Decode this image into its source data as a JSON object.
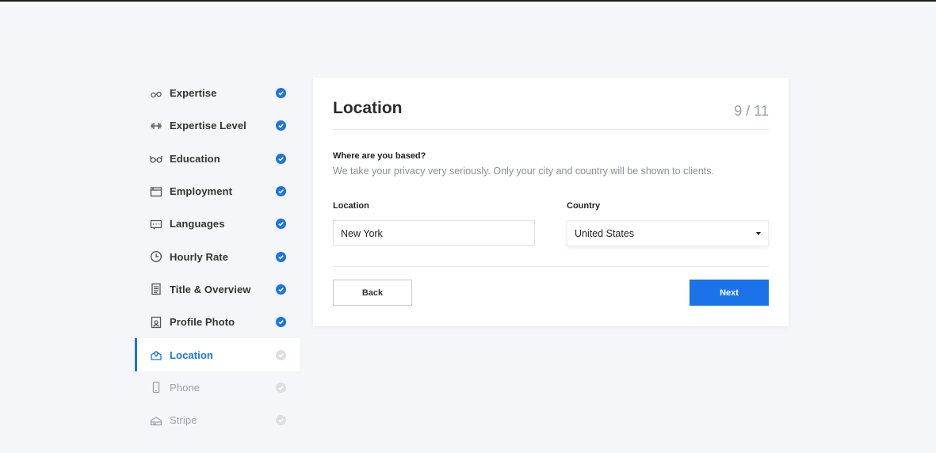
{
  "sidebar": {
    "items": [
      {
        "label": "Expertise",
        "icon": "binoculars-icon",
        "state": "done"
      },
      {
        "label": "Expertise Level",
        "icon": "dumbbell-icon",
        "state": "done"
      },
      {
        "label": "Education",
        "icon": "glasses-icon",
        "state": "done"
      },
      {
        "label": "Employment",
        "icon": "browser-window-icon",
        "state": "done"
      },
      {
        "label": "Languages",
        "icon": "keyboard-icon",
        "state": "done"
      },
      {
        "label": "Hourly Rate",
        "icon": "clock-icon",
        "state": "done"
      },
      {
        "label": "Title & Overview",
        "icon": "document-icon",
        "state": "done"
      },
      {
        "label": "Profile Photo",
        "icon": "photo-icon",
        "state": "done"
      },
      {
        "label": "Location",
        "icon": "map-pin-icon",
        "state": "active"
      },
      {
        "label": "Phone",
        "icon": "phone-icon",
        "state": "pending"
      },
      {
        "label": "Stripe",
        "icon": "stripe-icon",
        "state": "pending"
      }
    ]
  },
  "card": {
    "title": "Location",
    "counter": "9 / 11",
    "question": "Where are you based?",
    "privacy_note": "We take your privacy very seriously. Only your city and country will be shown to clients.",
    "location_label": "Location",
    "location_value": "New York",
    "country_label": "Country",
    "country_value": "United States",
    "back_label": "Back",
    "next_label": "Next"
  },
  "colors": {
    "accent": "#1a73e8",
    "background": "#f4f6f9",
    "muted": "#9aa0a6"
  }
}
